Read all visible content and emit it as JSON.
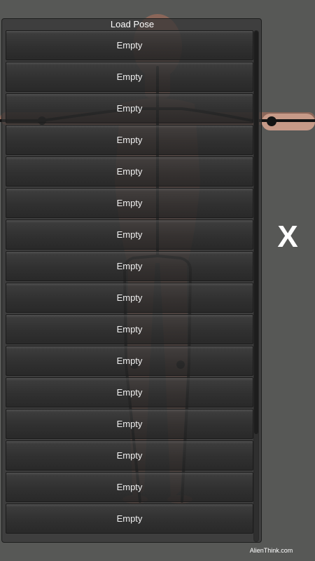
{
  "panel": {
    "title": "Load Pose",
    "slots": [
      "Empty",
      "Empty",
      "Empty",
      "Empty",
      "Empty",
      "Empty",
      "Empty",
      "Empty",
      "Empty",
      "Empty",
      "Empty",
      "Empty",
      "Empty",
      "Empty",
      "Empty",
      "Empty"
    ]
  },
  "close_label": "X",
  "brand": "AlienThink.com",
  "colors": {
    "background": "#575856",
    "skin": "#a87d6c",
    "bones": "#111111"
  }
}
